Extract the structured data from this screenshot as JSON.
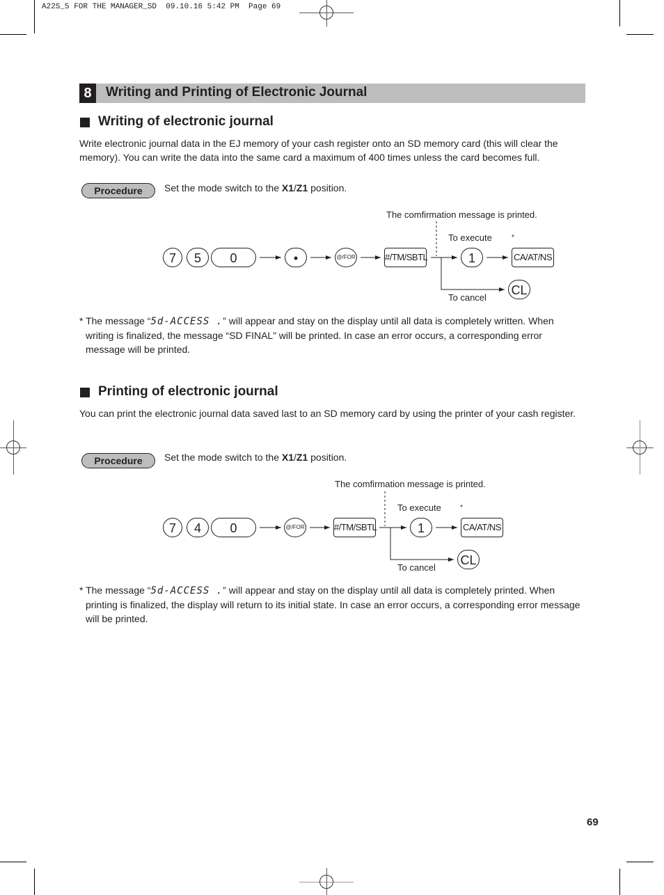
{
  "slug_line": "A22S_5 FOR THE MANAGER_SD  09.10.16 5:42 PM  Page 69",
  "chapter": {
    "number": "8",
    "title": "Writing and Printing of Electronic Journal"
  },
  "writing": {
    "heading": "Writing of electronic journal",
    "paragraph": "Write electronic journal data in the EJ memory of your cash register onto an SD memory card (this will clear the memory). You can write the data into the same card a maximum of 400 times unless the card becomes full.",
    "procedure_label": "Procedure",
    "procedure_text_pre": "Set the mode switch to the ",
    "procedure_text_bold1": "X1",
    "procedure_text_sep": "/",
    "procedure_text_bold2": "Z1",
    "procedure_text_post": " position.",
    "diagram": {
      "confirmation_note": "The comfirmation message is printed.",
      "to_execute": "To execute",
      "to_cancel": "To cancel",
      "asterisk": "*",
      "keys": [
        "7",
        "5",
        "0",
        "•",
        "@/FOR",
        "#/TM/SBTL",
        "1",
        "CA/AT/NS",
        "CL"
      ]
    },
    "footnote_pre": "* The message “",
    "footnote_display": "5d-ACCESS .",
    "footnote_post": "” will appear and stay on the display until all data is completely written. When writing is finalized, the message “SD FINAL” will be printed. In case an error occurs, a corresponding error message will be printed."
  },
  "printing": {
    "heading": "Printing of electronic journal",
    "paragraph": "You can print the electronic journal data saved last to an SD memory card by using the printer of your cash register.",
    "procedure_label": "Procedure",
    "procedure_text_pre": "Set the mode switch to the ",
    "procedure_text_bold1": "X1",
    "procedure_text_sep": "/",
    "procedure_text_bold2": "Z1",
    "procedure_text_post": " position.",
    "diagram": {
      "confirmation_note": "The comfirmation message is printed.",
      "to_execute": "To execute",
      "to_cancel": "To cancel",
      "asterisk": "*",
      "keys": [
        "7",
        "4",
        "0",
        "@/FOR",
        "#/TM/SBTL",
        "1",
        "CA/AT/NS",
        "CL"
      ]
    },
    "footnote_pre": "* The message “",
    "footnote_display": "5d-ACCESS .",
    "footnote_post": "” will appear and stay on the display until all data is completely printed. When printing is finalized, the display will return to its initial state. In case an error occurs, a corresponding error message will be printed."
  },
  "page_number": "69"
}
